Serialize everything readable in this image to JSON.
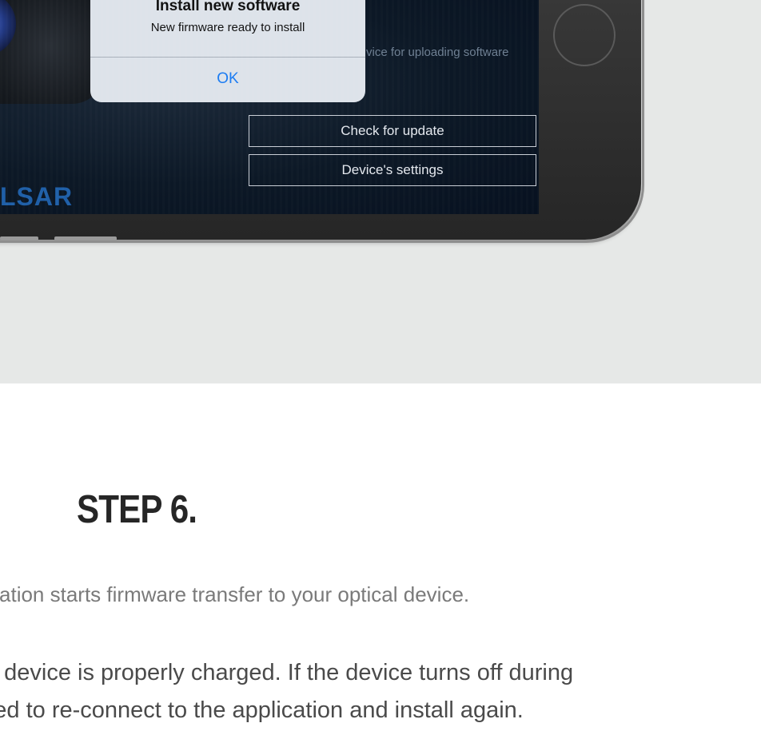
{
  "dialog": {
    "title": "Install new software",
    "message": "New firmware ready to install",
    "ok_label": "OK"
  },
  "app_screen": {
    "brand_fragment": "LSAR",
    "upload_hint": "vice for uploading software",
    "check_update_label": "Check for update",
    "settings_label": "Device's settings"
  },
  "section": {
    "step_title": "STEP 6.",
    "line1": "plication starts firmware transfer to your optical device.",
    "line2": "cal device is properly charged. If the device turns off during",
    "line3": "need to re-connect to the application and install again."
  },
  "colors": {
    "hero_bg": "#e6e8e7",
    "screen_bg": "#0c1826",
    "dialog_bg": "#dde3ea",
    "ios_blue": "#1a7bf2",
    "brand_blue": "#1f5fa8"
  }
}
